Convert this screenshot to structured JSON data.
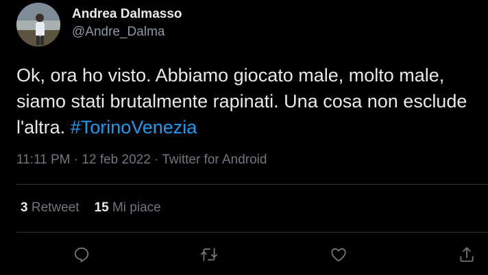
{
  "tweet": {
    "author_name": "Andrea Dalmasso",
    "author_handle": "@Andre_Dalma",
    "text_lines": [
      "Ok, ora ho visto. Abbiamo giocato male, molto male,",
      "siamo stati brutalmente rapinati. Una cosa non esclude",
      "l'altra. "
    ],
    "hashtag": "#TorinoVenezia",
    "time": "11:11 PM",
    "date": "12 feb 2022",
    "source": "Twitter for Android",
    "meta_separator": " · ",
    "retweets_count": "3",
    "retweets_label": "Retweet",
    "likes_count": "15",
    "likes_label": "Mi piace"
  },
  "actions": [
    {
      "icon": "reply-icon"
    },
    {
      "icon": "retweet-icon"
    },
    {
      "icon": "like-icon"
    },
    {
      "icon": "share-icon"
    }
  ],
  "colors": {
    "background": "#000000",
    "text": "#e7e9ea",
    "secondary": "#71767b",
    "link": "#1d9bf0",
    "divider": "#2f3336"
  }
}
